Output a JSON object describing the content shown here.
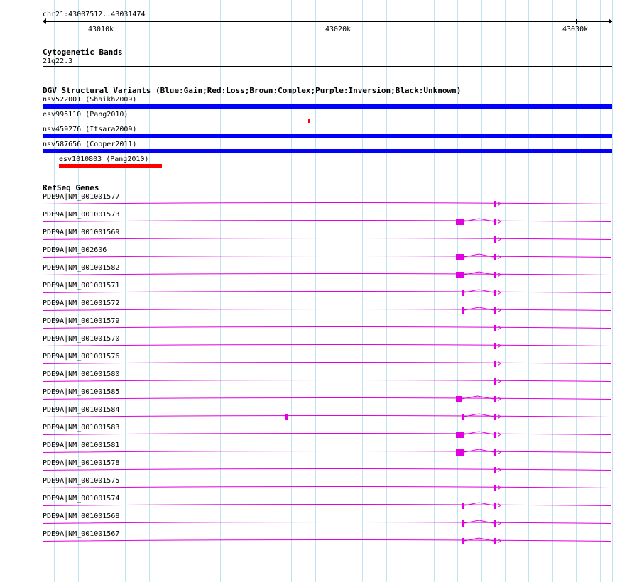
{
  "ruler": {
    "range_label": "chr21:43007512..43031474",
    "ticks": [
      "43010k",
      "43020k",
      "43030k"
    ]
  },
  "cytoband": {
    "title": "Cytogenetic Bands",
    "band": "21q22.3"
  },
  "dgv": {
    "title": "DGV Structural Variants (Blue:Gain;Red:Loss;Brown:Complex;Purple:Inversion;Black:Unknown)",
    "variants": [
      {
        "label": "nsv522001 (Shaikh2009)",
        "type": "Gain",
        "color": "#0000ff"
      },
      {
        "label": "esv995110 (Pang2010)",
        "type": "Loss",
        "color": "#ff0000"
      },
      {
        "label": "nsv459276 (Itsara2009)",
        "type": "Gain",
        "color": "#0000ff"
      },
      {
        "label": "nsv587656 (Cooper2011)",
        "type": "Gain",
        "color": "#0000ff"
      },
      {
        "label": "esv1010803 (Pang2010)",
        "type": "Loss",
        "color": "#ff0000"
      }
    ]
  },
  "refseq": {
    "title": "RefSeq Genes",
    "color": "#e000e0",
    "genes": [
      {
        "label": "PDE9A|NM_001001577"
      },
      {
        "label": "PDE9A|NM_001001573"
      },
      {
        "label": "PDE9A|NM_001001569"
      },
      {
        "label": "PDE9A|NM_002606"
      },
      {
        "label": "PDE9A|NM_001001582"
      },
      {
        "label": "PDE9A|NM_001001571"
      },
      {
        "label": "PDE9A|NM_001001572"
      },
      {
        "label": "PDE9A|NM_001001579"
      },
      {
        "label": "PDE9A|NM_001001570"
      },
      {
        "label": "PDE9A|NM_001001576"
      },
      {
        "label": "PDE9A|NM_001001580"
      },
      {
        "label": "PDE9A|NM_001001585"
      },
      {
        "label": "PDE9A|NM_001001584"
      },
      {
        "label": "PDE9A|NM_001001583"
      },
      {
        "label": "PDE9A|NM_001001581"
      },
      {
        "label": "PDE9A|NM_001001578"
      },
      {
        "label": "PDE9A|NM_001001575"
      },
      {
        "label": "PDE9A|NM_001001574"
      },
      {
        "label": "PDE9A|NM_001001568"
      },
      {
        "label": "PDE9A|NM_001001567"
      }
    ]
  }
}
